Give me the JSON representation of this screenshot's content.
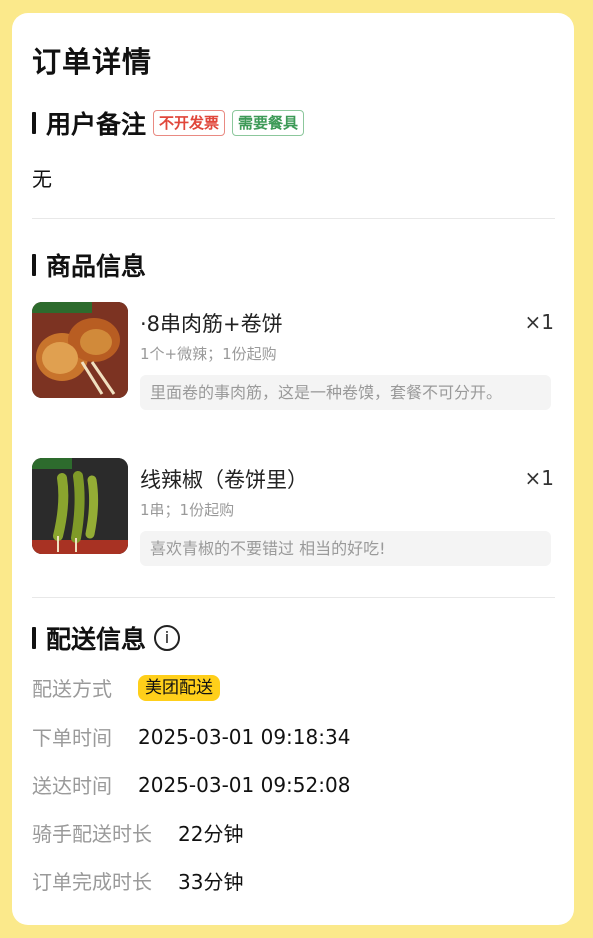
{
  "page": {
    "title": "订单详情"
  },
  "remark_section": {
    "title": "用户备注",
    "tags": [
      "不开发票",
      "需要餐具"
    ],
    "remark": "无"
  },
  "goods_section": {
    "title": "商品信息",
    "items": [
      {
        "name": "·8串肉筋+卷饼",
        "qty": "×1",
        "spec": "1个+微辣；1份起购",
        "note": "里面卷的事肉筋，这是一种卷馍，套餐不可分开。",
        "thumb_label": "8串肉筋+卷饼"
      },
      {
        "name": "线辣椒（卷饼里）",
        "qty": "×1",
        "spec": "1串；1份起购",
        "note": "喜欢青椒的不要错过 相当的好吃!",
        "thumb_label": "肉辣椒"
      }
    ]
  },
  "delivery_section": {
    "title": "配送信息",
    "rows": [
      {
        "label": "配送方式",
        "value": "美团配送"
      },
      {
        "label": "下单时间",
        "value": "2025-03-01 09:18:34"
      },
      {
        "label": "送达时间",
        "value": "2025-03-01 09:52:08"
      },
      {
        "label": "骑手配送时长",
        "value": "22分钟"
      },
      {
        "label": "订单完成时长",
        "value": "33分钟"
      }
    ]
  },
  "colors": {
    "background": "#fbe98b",
    "badge": "#ffcf1a",
    "tag_red": "#e0473b",
    "tag_green": "#3d9a57"
  }
}
